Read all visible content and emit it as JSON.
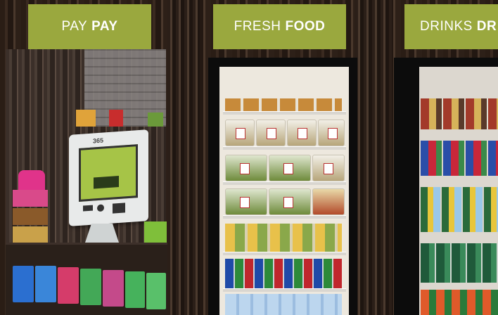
{
  "signs": {
    "pay": {
      "light": "PAY",
      "bold": "PAY"
    },
    "food": {
      "light": "FRESH",
      "bold": "FOOD"
    },
    "drinks": {
      "light": "DRINKS",
      "bold": "DR"
    }
  },
  "kiosk": {
    "logo": "365"
  },
  "colors": {
    "sign": "#9aa83e",
    "wood": "#2d2018",
    "screen": "#a6c447"
  }
}
